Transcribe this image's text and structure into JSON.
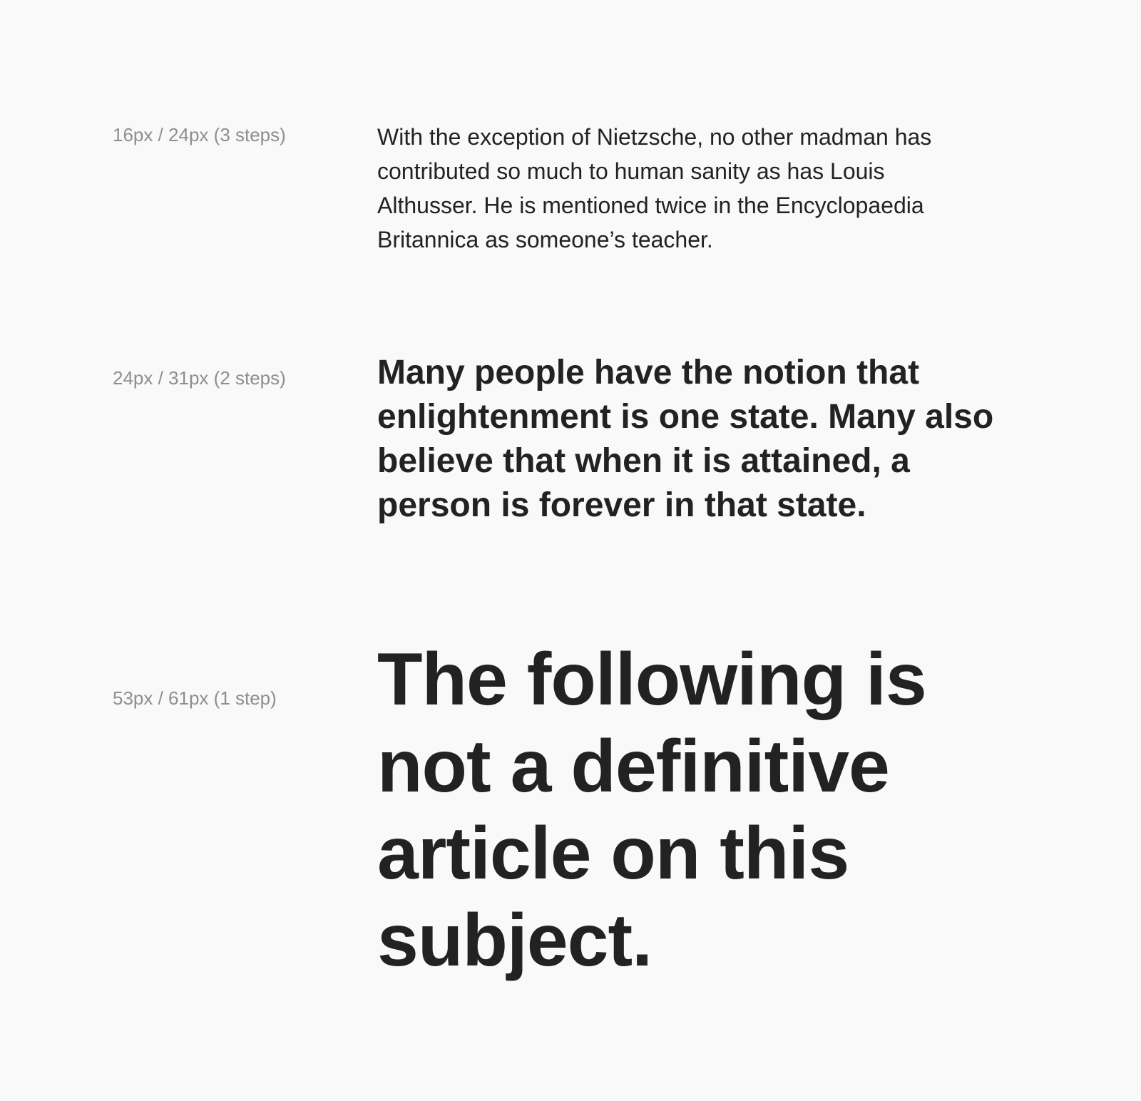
{
  "background_color": "#f9f9f9",
  "label_color": "#8e8e8e",
  "text_color": "#222222",
  "rows": [
    {
      "label": "16px / 24px (3 steps)",
      "sample": "With the exception of Nietzsche, no other madman has contributed so much to human sanity as has Louis Althusser. He is mentioned twice in the Encyclopaedia Britannica as someone’s teacher."
    },
    {
      "label": "24px / 31px (2 steps)",
      "sample": "Many people have the notion that enlightenment is one state. Many also believe that when it is attained, a person is forever in that state."
    },
    {
      "label": "53px / 61px (1 step)",
      "sample": "The following is not a definitive article on this subject."
    }
  ]
}
